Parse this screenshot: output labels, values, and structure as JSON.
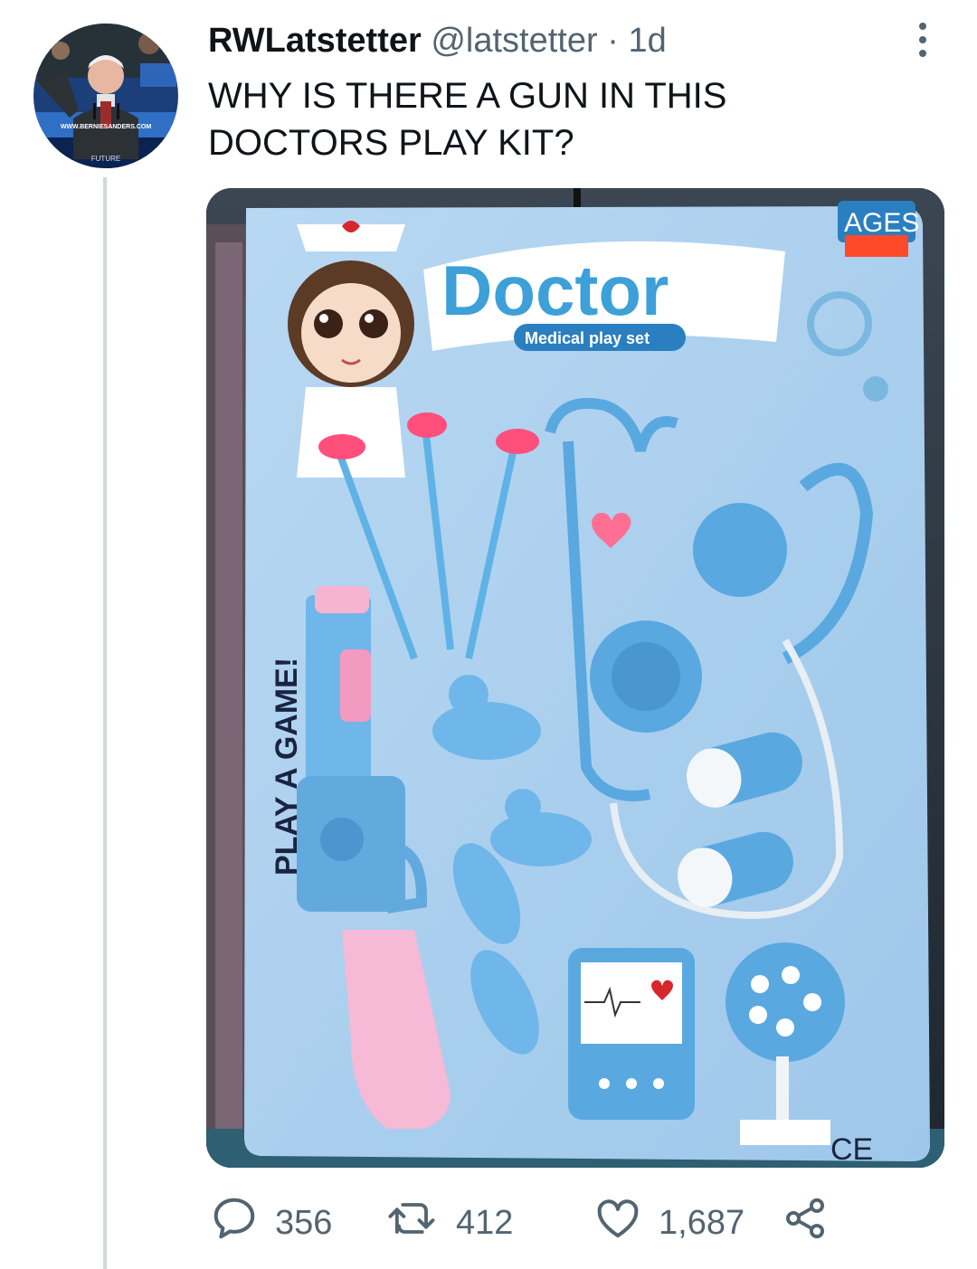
{
  "tweet": {
    "display_name": "RWLatstetter",
    "handle": "@latstetter",
    "separator": "·",
    "time": "1d",
    "text_lines": [
      "WHY IS THERE A GUN IN THIS",
      "DOCTORS PLAY KIT?"
    ]
  },
  "media": {
    "package_title": "Doctor",
    "package_subtitle": "Medical play set",
    "side_text": "PLAY A GAME!",
    "ages_label": "AGES",
    "ce_mark": "CE"
  },
  "actions": {
    "reply_count": "356",
    "retweet_count": "412",
    "like_count": "1,687"
  },
  "avatar_text": {
    "banner": "WWW.BERNIESANDERS.COM",
    "footer": "FUTURE"
  },
  "icons": [
    "more-icon",
    "reply-icon",
    "retweet-icon",
    "like-icon",
    "share-icon"
  ]
}
